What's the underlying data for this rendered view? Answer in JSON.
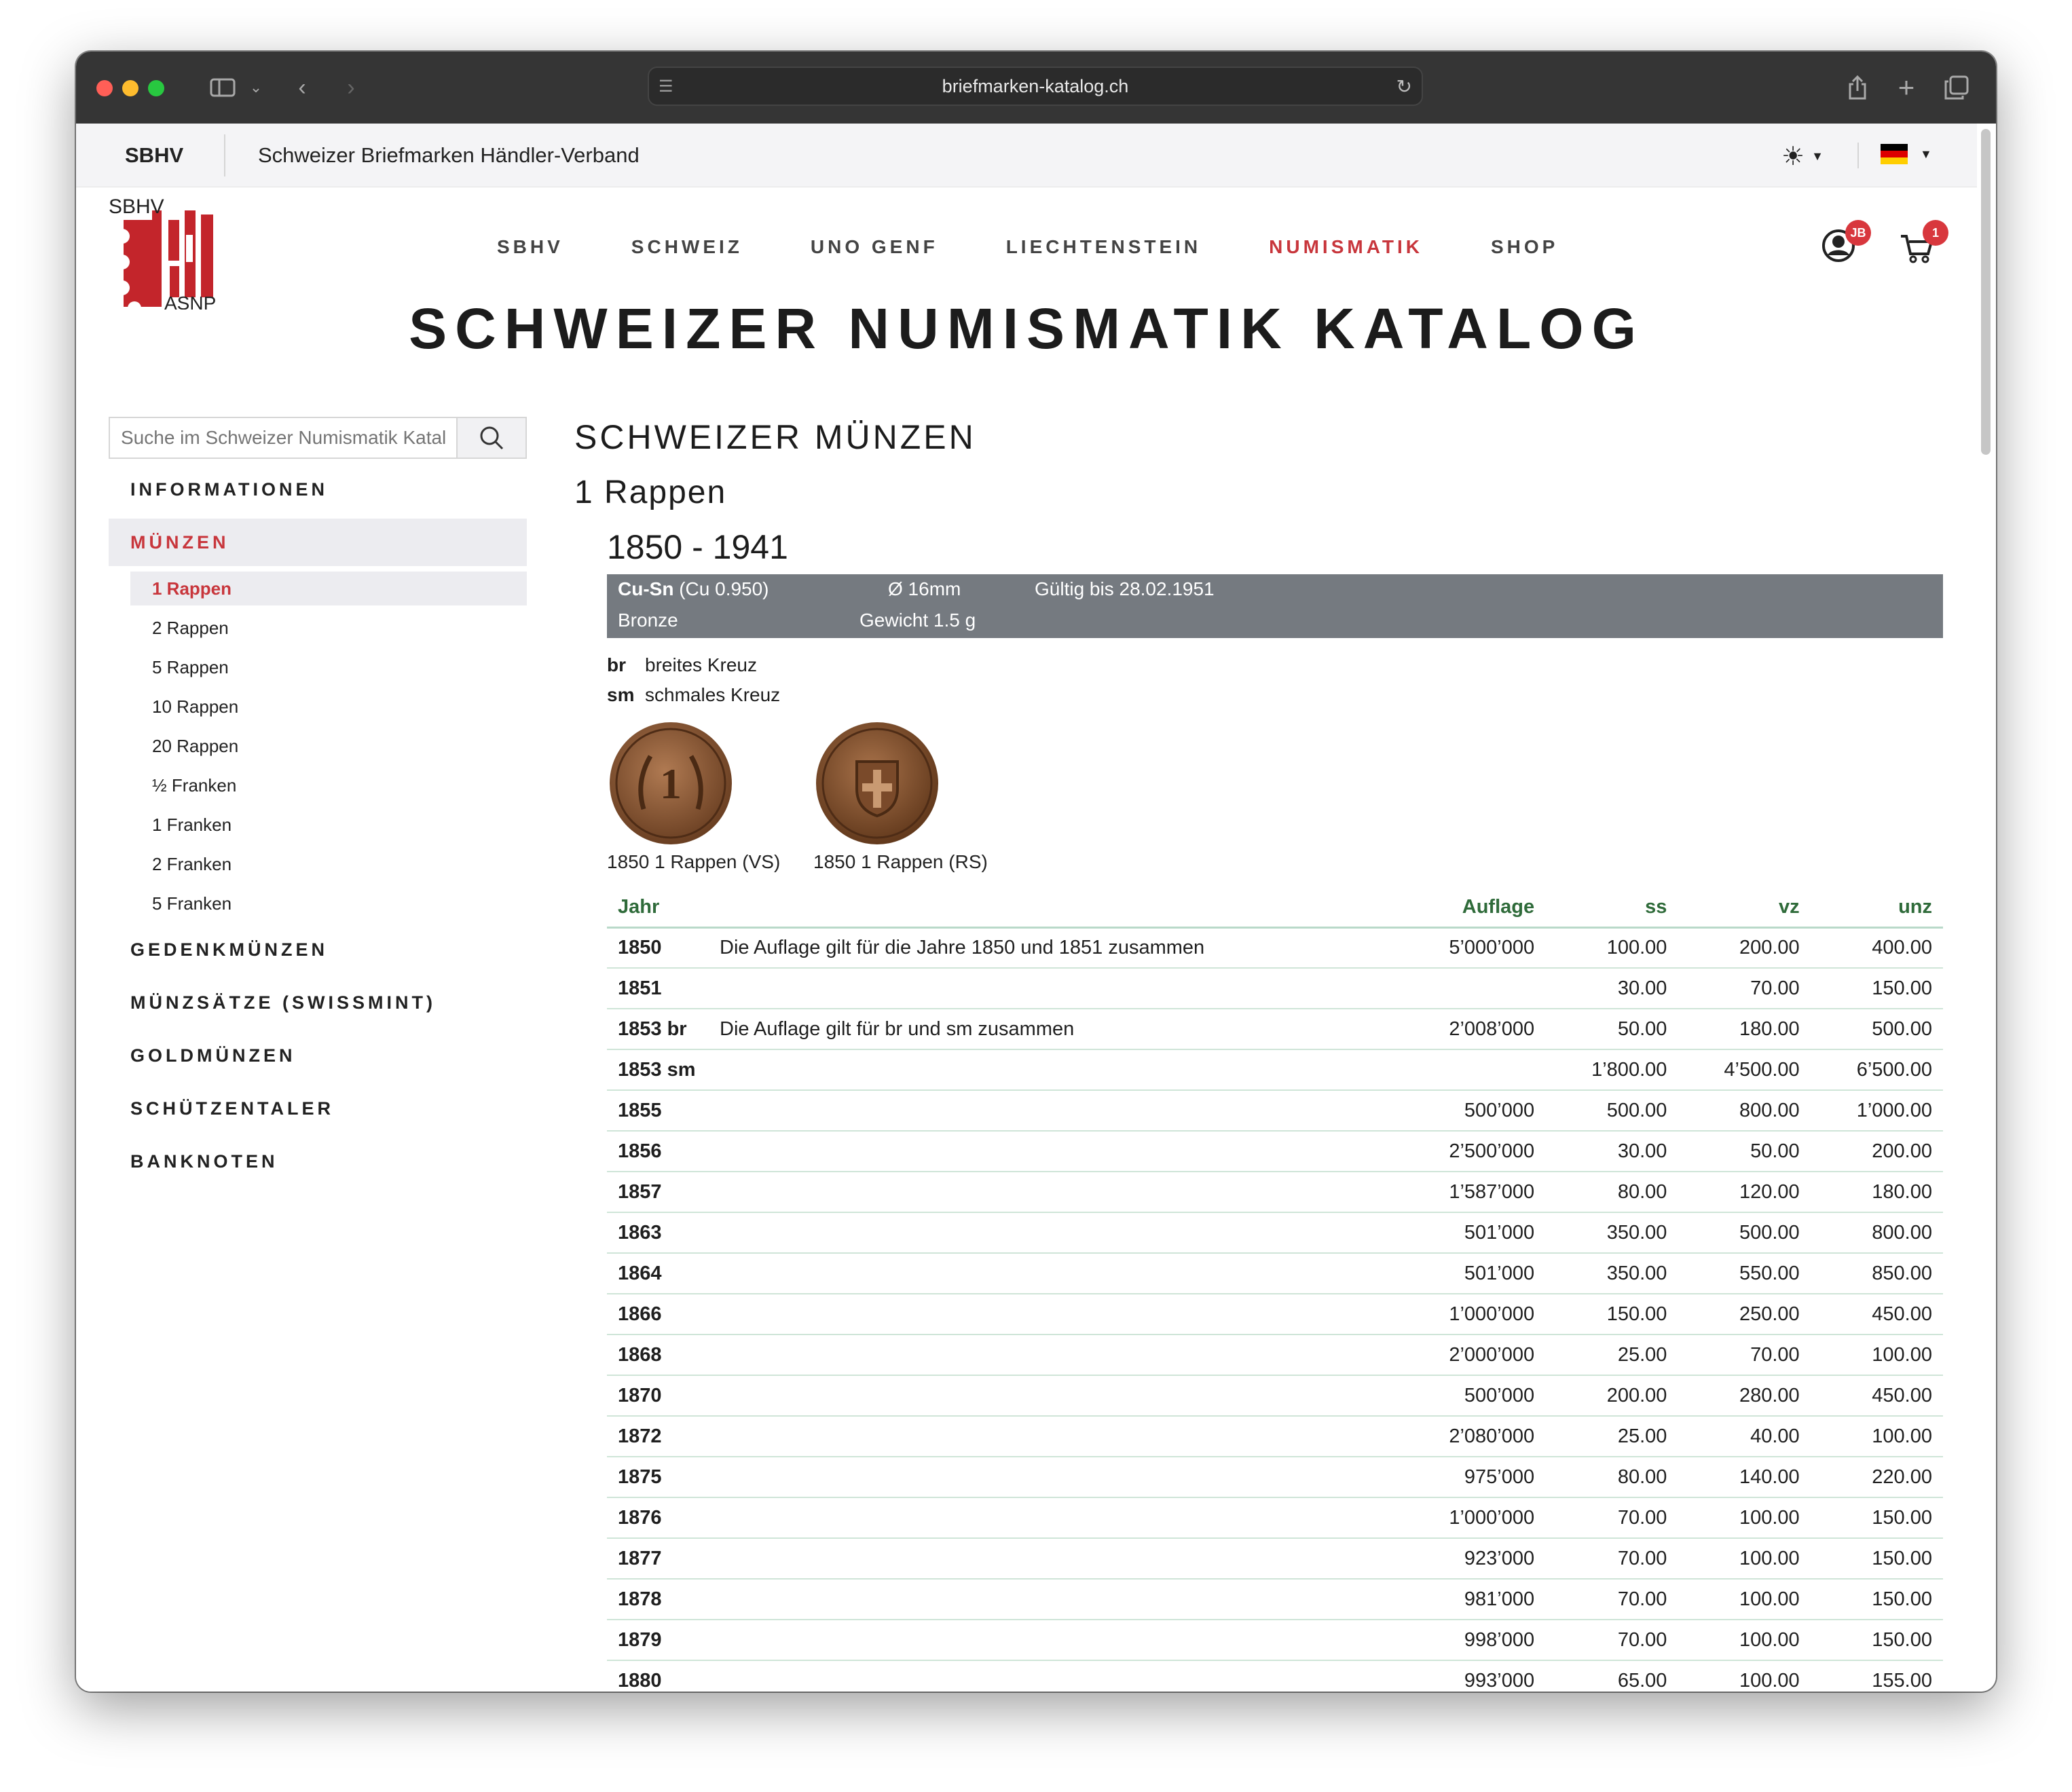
{
  "browser": {
    "url": "briefmarken-katalog.ch"
  },
  "topbar": {
    "brand": "SBHV",
    "title": "Schweizer Briefmarken Händler-Verband"
  },
  "logo": {
    "top_text": "SBHV",
    "bottom_text": "ASNP"
  },
  "nav": [
    {
      "label": "SBHV",
      "active": false
    },
    {
      "label": "SCHWEIZ",
      "active": false
    },
    {
      "label": "UNO GENF",
      "active": false
    },
    {
      "label": "LIECHTENSTEIN",
      "active": false
    },
    {
      "label": "NUMISMATIK",
      "active": true
    },
    {
      "label": "SHOP",
      "active": false
    }
  ],
  "account_badge": "JB",
  "cart_badge": "1",
  "page_title": "SCHWEIZER NUMISMATIK KATALOG",
  "search": {
    "placeholder": "Suche im Schweizer Numismatik Katalog"
  },
  "sidebar": {
    "categories_top": [
      {
        "label": "INFORMATIONEN"
      }
    ],
    "active_category": "MÜNZEN",
    "subitems": [
      {
        "label": "1 Rappen",
        "active": true
      },
      {
        "label": "2 Rappen"
      },
      {
        "label": "5 Rappen"
      },
      {
        "label": "10 Rappen"
      },
      {
        "label": "20 Rappen"
      },
      {
        "label": "½ Franken"
      },
      {
        "label": "1 Franken"
      },
      {
        "label": "2 Franken"
      },
      {
        "label": "5 Franken"
      }
    ],
    "categories_bottom": [
      {
        "label": "GEDENKMÜNZEN"
      },
      {
        "label": "MÜNZSÄTZE (SWISSMINT)"
      },
      {
        "label": "GOLDMÜNZEN"
      },
      {
        "label": "SCHÜTZENTALER"
      },
      {
        "label": "BANKNOTEN"
      }
    ]
  },
  "content": {
    "section": "SCHWEIZER MÜNZEN",
    "denomination": "1 Rappen",
    "period": "1850 - 1941",
    "info": {
      "alloy_bold": "Cu-Sn",
      "alloy_detail": "(Cu 0.950)",
      "material": "Bronze",
      "diameter": "Ø 16mm",
      "weight": "Gewicht 1.5 g",
      "validity": "Gültig bis 28.02.1951"
    },
    "legend": [
      {
        "abbr": "br",
        "text": "breites Kreuz"
      },
      {
        "abbr": "sm",
        "text": "schmales Kreuz"
      }
    ],
    "images": [
      {
        "caption": "1850 1 Rappen (VS)",
        "icon": "coin-obverse"
      },
      {
        "caption": "1850 1 Rappen (RS)",
        "icon": "coin-reverse"
      }
    ],
    "table": {
      "headers": [
        "Jahr",
        "",
        "Auflage",
        "ss",
        "vz",
        "unz"
      ],
      "rows": [
        [
          "1850",
          "Die Auflage gilt für die Jahre 1850 und 1851 zusammen",
          "5’000’000",
          "100.00",
          "200.00",
          "400.00"
        ],
        [
          "1851",
          "",
          "",
          "30.00",
          "70.00",
          "150.00"
        ],
        [
          "1853 br",
          "Die Auflage gilt für br und sm zusammen",
          "2’008’000",
          "50.00",
          "180.00",
          "500.00"
        ],
        [
          "1853 sm",
          "",
          "",
          "1’800.00",
          "4’500.00",
          "6’500.00"
        ],
        [
          "1855",
          "",
          "500’000",
          "500.00",
          "800.00",
          "1’000.00"
        ],
        [
          "1856",
          "",
          "2’500’000",
          "30.00",
          "50.00",
          "200.00"
        ],
        [
          "1857",
          "",
          "1’587’000",
          "80.00",
          "120.00",
          "180.00"
        ],
        [
          "1863",
          "",
          "501’000",
          "350.00",
          "500.00",
          "800.00"
        ],
        [
          "1864",
          "",
          "501’000",
          "350.00",
          "550.00",
          "850.00"
        ],
        [
          "1866",
          "",
          "1’000’000",
          "150.00",
          "250.00",
          "450.00"
        ],
        [
          "1868",
          "",
          "2’000’000",
          "25.00",
          "70.00",
          "100.00"
        ],
        [
          "1870",
          "",
          "500’000",
          "200.00",
          "280.00",
          "450.00"
        ],
        [
          "1872",
          "",
          "2’080’000",
          "25.00",
          "40.00",
          "100.00"
        ],
        [
          "1875",
          "",
          "975’000",
          "80.00",
          "140.00",
          "220.00"
        ],
        [
          "1876",
          "",
          "1’000’000",
          "70.00",
          "100.00",
          "150.00"
        ],
        [
          "1877",
          "",
          "923’000",
          "70.00",
          "100.00",
          "150.00"
        ],
        [
          "1878",
          "",
          "981’000",
          "70.00",
          "100.00",
          "150.00"
        ],
        [
          "1879",
          "",
          "998’000",
          "70.00",
          "100.00",
          "150.00"
        ],
        [
          "1880",
          "",
          "993’000",
          "65.00",
          "100.00",
          "155.00"
        ]
      ]
    }
  },
  "colors": {
    "accent": "#c8363c",
    "table_header": "#2f6b3a",
    "infobox": "#757a80",
    "chrome": "#353535"
  }
}
